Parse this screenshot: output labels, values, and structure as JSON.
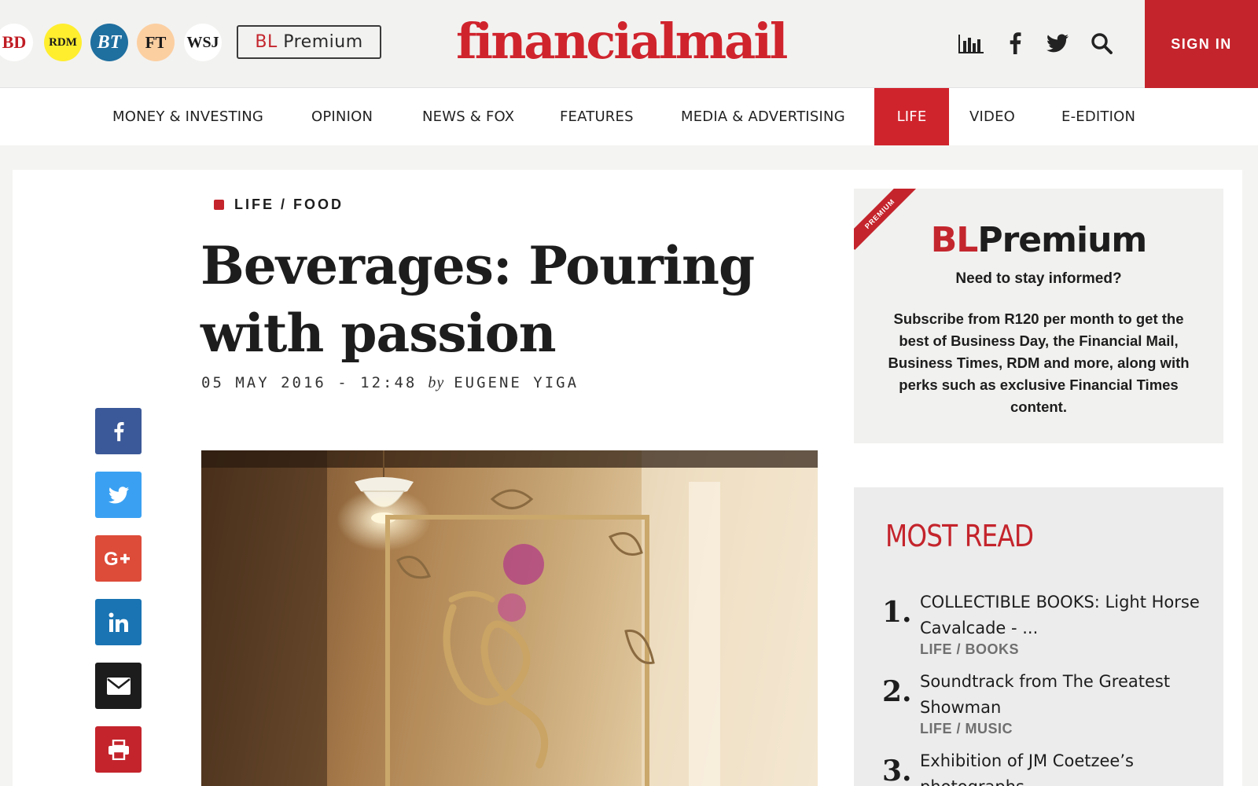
{
  "header": {
    "publications": [
      "BD",
      "RDM",
      "BT",
      "FT",
      "WSJ"
    ],
    "premium_button": {
      "prefix": "BL",
      "suffix": " Premium"
    },
    "logo": "financialmail",
    "icons": [
      "chart-icon",
      "facebook-icon",
      "twitter-icon",
      "search-icon"
    ],
    "sign_in": "SIGN IN",
    "brand_color": "#c4242c"
  },
  "nav": {
    "items": [
      "MONEY & INVESTING",
      "OPINION",
      "NEWS & FOX",
      "FEATURES",
      "MEDIA & ADVERTISING",
      "LIFE",
      "VIDEO",
      "E-EDITION"
    ],
    "active": "LIFE"
  },
  "article": {
    "breadcrumb": "LIFE / FOOD",
    "title": "Beverages: Pouring with passion",
    "date": "05 MAY 2016 - 12:48",
    "by": "by",
    "author": "EUGENE YIGA"
  },
  "share": {
    "buttons": [
      "facebook",
      "twitter",
      "google-plus",
      "linkedin",
      "email",
      "print"
    ]
  },
  "promo": {
    "ribbon": "PREMIUM",
    "logo_prefix": "BL",
    "logo_suffix": "Premium",
    "question": "Need to stay informed?",
    "body": "Subscribe from R120 per month to get the best of Business Day, the Financial Mail, Business Times, RDM and more, along with perks such as exclusive Financial Times content."
  },
  "most_read": {
    "title": "MOST READ",
    "items": [
      {
        "num": "1.",
        "text": "COLLECTIBLE BOOKS: Light Horse Cavalcade - ...",
        "cat": "LIFE / BOOKS"
      },
      {
        "num": "2.",
        "text": "Soundtrack from The Greatest Showman",
        "cat": "LIFE / MUSIC"
      },
      {
        "num": "3.",
        "text": "Exhibition of JM Coetzee’s photographs"
      }
    ]
  }
}
